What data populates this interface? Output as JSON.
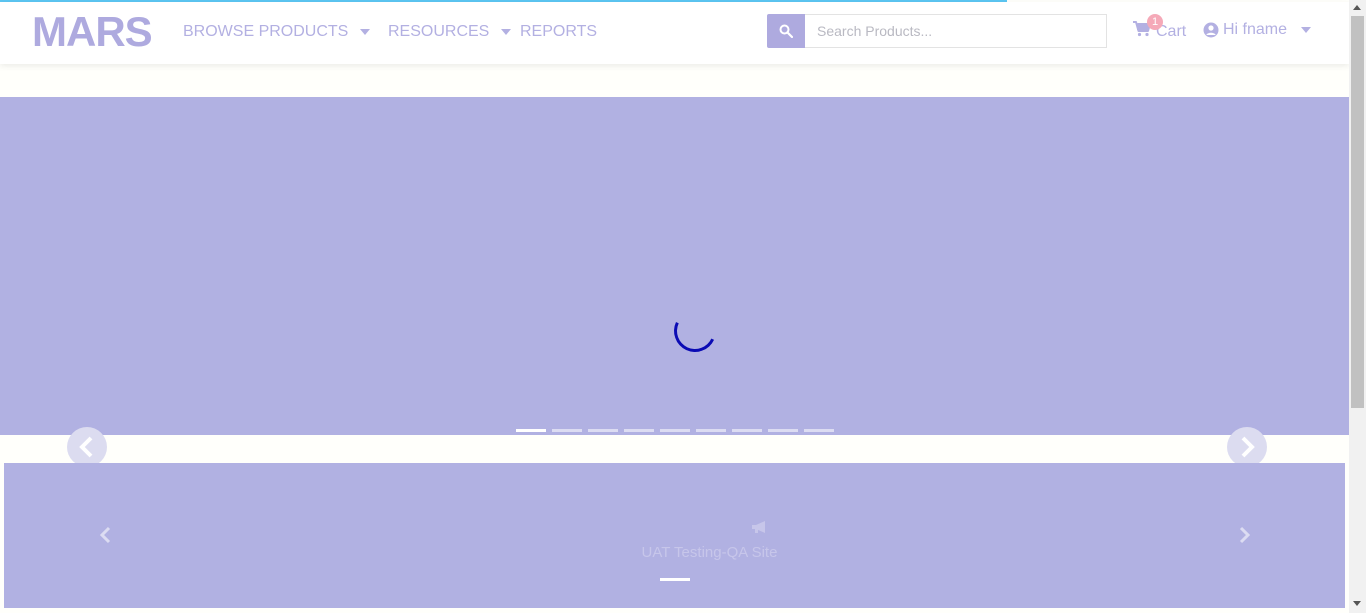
{
  "brand": {
    "logo_text": "MARS"
  },
  "nav": {
    "items": [
      {
        "label": "BROWSE PRODUCTS",
        "has_dropdown": true
      },
      {
        "label": "RESOURCES",
        "has_dropdown": true
      },
      {
        "label": "REPORTS",
        "has_dropdown": false
      }
    ]
  },
  "search": {
    "placeholder": "Search Products...",
    "value": "",
    "icon": "search-icon"
  },
  "cart": {
    "label": "Cart",
    "count": "1",
    "icon": "cart-icon"
  },
  "user": {
    "greeting": "Hi fname",
    "icon": "user-circle-icon"
  },
  "hero_carousel": {
    "slide_count": 9,
    "active_index": 0,
    "loading": true
  },
  "announcement": {
    "icon": "megaphone-icon",
    "text": "UAT Testing-QA Site",
    "slide_count": 1
  },
  "colors": {
    "accent": "#aeaadf",
    "overlay": "#b1b1e2",
    "spinner": "#0b0bb4",
    "progress": "#5cc6f2",
    "badge": "#f5a9b8"
  }
}
